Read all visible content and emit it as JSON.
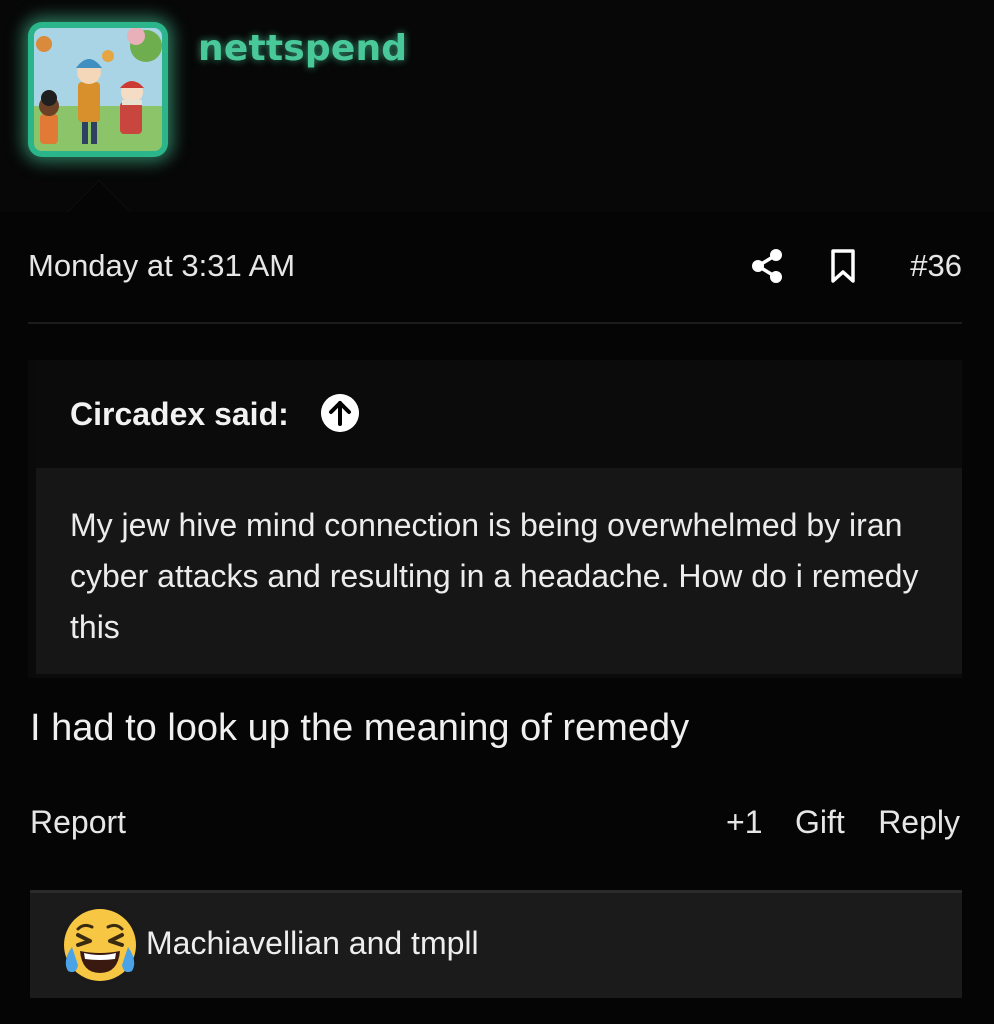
{
  "user": {
    "username": "nettspend"
  },
  "post": {
    "date": "Monday at 3:31 AM",
    "number": "#36",
    "quote": {
      "author_label": "Circadex said:",
      "text": "My jew hive mind connection is being overwhelmed by iran cyber attacks and resulting in a headache. How do i remedy this"
    },
    "body": "I had to look up the meaning of remedy"
  },
  "actions": {
    "report": "Report",
    "plus_one": "+1",
    "gift": "Gift",
    "reply": "Reply"
  },
  "reactions": {
    "icon": "laughing-crying-emoji",
    "users": "Machiavellian and tmpll"
  },
  "colors": {
    "username": "#49c99a",
    "avatar_glow": "#48d2a0",
    "background": "#050505",
    "quote_body": "#161616",
    "reaction_bar": "#1b1b1b"
  }
}
